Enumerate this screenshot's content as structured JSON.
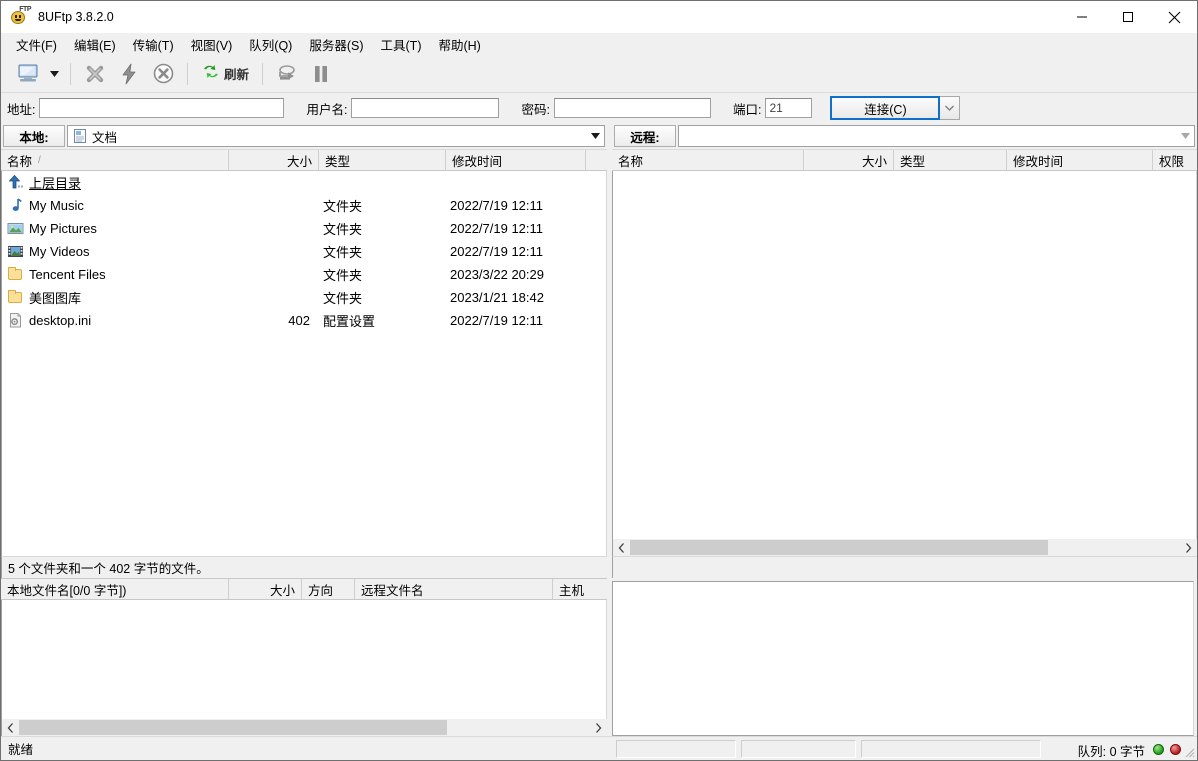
{
  "window": {
    "title": "8UFtp 3.8.2.0",
    "icon": "app-ftp-icon",
    "minimize": "minimize",
    "maximize": "maximize",
    "close": "close"
  },
  "menubar": {
    "items": [
      {
        "label": "文件(F)",
        "text": "文件",
        "mnemonic": "(F)"
      },
      {
        "label": "编辑(E)",
        "text": "编辑",
        "mnemonic": "(E)"
      },
      {
        "label": "传输(T)",
        "text": "传输",
        "mnemonic": "(T)"
      },
      {
        "label": "视图(V)",
        "text": "视图",
        "mnemonic": "(V)"
      },
      {
        "label": "队列(Q)",
        "text": "队列",
        "mnemonic": "(Q)"
      },
      {
        "label": "服务器(S)",
        "text": "服务器",
        "mnemonic": "(S)"
      },
      {
        "label": "工具(T)",
        "text": "工具",
        "mnemonic": "(T)"
      },
      {
        "label": "帮助(H)",
        "text": "帮助",
        "mnemonic": "(H)"
      }
    ]
  },
  "toolbar": {
    "site_manager_icon": "site-manager-icon",
    "dropdown_icon": "chevron-down-icon",
    "disconnect_icon": "disconnect-x-icon",
    "quickconnect_icon": "lightning-icon",
    "stop_icon": "stop-circle-icon",
    "refresh_icon": "refresh-icon",
    "refresh_label": "刷新",
    "transfer_icon": "transfer-icon",
    "pause_icon": "pause-icon"
  },
  "connectbar": {
    "address_label": "地址:",
    "address_value": "",
    "address_placeholder": "",
    "user_label": "用户名:",
    "user_value": "",
    "password_label": "密码:",
    "password_value": "",
    "port_label": "端口:",
    "port_value": "21",
    "connect_label": "连接(C)",
    "connect_dropdown_icon": "chevron-down-icon"
  },
  "local": {
    "panel_label": "本地:",
    "path_value": "文档",
    "path_icon": "documents-icon",
    "path_dropdown_icon": "chevron-down-icon",
    "columns": [
      {
        "label": "名称",
        "sort": "/"
      },
      {
        "label": "大小",
        "sort": ""
      },
      {
        "label": "类型",
        "sort": ""
      },
      {
        "label": "修改时间",
        "sort": ""
      }
    ],
    "rows": [
      {
        "icon": "up-directory-icon",
        "name": "上层目录",
        "size": "",
        "type": "",
        "date": ""
      },
      {
        "icon": "music-icon",
        "name": "My Music",
        "size": "",
        "type": "文件夹",
        "date": "2022/7/19 12:11"
      },
      {
        "icon": "pictures-icon",
        "name": "My Pictures",
        "size": "",
        "type": "文件夹",
        "date": "2022/7/19 12:11"
      },
      {
        "icon": "videos-icon",
        "name": "My Videos",
        "size": "",
        "type": "文件夹",
        "date": "2022/7/19 12:11"
      },
      {
        "icon": "folder-icon",
        "name": "Tencent Files",
        "size": "",
        "type": "文件夹",
        "date": "2023/3/22 20:29"
      },
      {
        "icon": "folder-icon",
        "name": "美图图库",
        "size": "",
        "type": "文件夹",
        "date": "2023/1/21 18:42"
      },
      {
        "icon": "config-file-icon",
        "name": "desktop.ini",
        "size": "402",
        "type": "配置设置",
        "date": "2022/7/19 12:11"
      }
    ],
    "status": "5 个文件夹和一个 402 字节的文件。"
  },
  "remote": {
    "panel_label": "远程:",
    "path_value": "",
    "path_dropdown_icon": "chevron-down-icon",
    "columns": [
      {
        "label": "名称"
      },
      {
        "label": "大小"
      },
      {
        "label": "类型"
      },
      {
        "label": "修改时间"
      },
      {
        "label": "权限"
      }
    ],
    "rows": [],
    "status": ""
  },
  "queue": {
    "columns": [
      {
        "label": "本地文件名[0/0 字节])"
      },
      {
        "label": "大小"
      },
      {
        "label": "方向"
      },
      {
        "label": "远程文件名"
      },
      {
        "label": "主机"
      }
    ],
    "rows": []
  },
  "statusbar": {
    "ready_text": "就绪",
    "queue_text": "队列: 0 字节",
    "led_green": "#1f9b20",
    "led_red": "#b81818",
    "resize_grip_icon": "resize-grip-icon"
  },
  "colors": {
    "window_bg": "#f0f0f0",
    "list_bg": "#ffffff",
    "accent_focus": "#0f70c9",
    "folder": "#fbe09a"
  }
}
